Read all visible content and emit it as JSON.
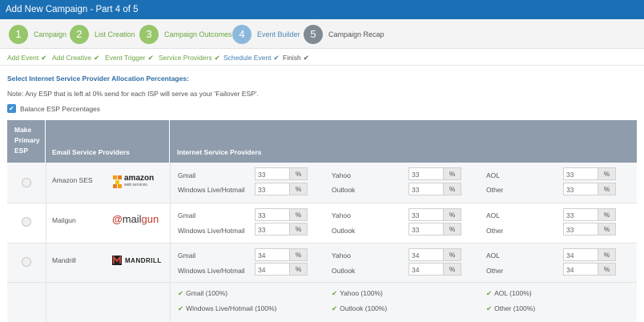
{
  "window": {
    "title": "Add New Campaign - Part 4 of 5"
  },
  "steps": [
    {
      "num": "1",
      "label": "Campaign"
    },
    {
      "num": "2",
      "label": "List Creation"
    },
    {
      "num": "3",
      "label": "Campaign Outcomes"
    },
    {
      "num": "4",
      "label": "Event Builder"
    },
    {
      "num": "5",
      "label": "Campaign Recap"
    }
  ],
  "substeps": [
    {
      "label": "Add Event",
      "check": "✔"
    },
    {
      "label": "Add Creative",
      "check": "✔"
    },
    {
      "label": "Event Trigger",
      "check": "✔"
    },
    {
      "label": "Service Providers",
      "check": "✔"
    },
    {
      "label": "Schedule Event",
      "check": "✔"
    },
    {
      "label": "Finish",
      "check": "✔"
    }
  ],
  "section_title": "Select Internet Service Provider Allocation Percentages:",
  "note": "Note: Any ESP that is left at 0% send for each ISP will serve as your 'Failover ESP'.",
  "balance": {
    "label": "Balance ESP Percentages",
    "checked": true,
    "check_glyph": "✔"
  },
  "table": {
    "headers": {
      "primary": "Make Primary ESP",
      "esp": "Email Service Providers",
      "isp": "Internet Service Providers"
    },
    "percent_sign": "%",
    "rows": [
      {
        "esp": "Amazon SES",
        "logo": {
          "text_main": "amazon",
          "text_sub": "web services",
          "icon": "amazon-cubes-icon"
        },
        "isps": [
          {
            "label": "Gmail",
            "value": "33"
          },
          {
            "label": "Windows Live/Hotmail",
            "value": "33"
          },
          {
            "label": "Yahoo",
            "value": "33"
          },
          {
            "label": "Outlook",
            "value": "33"
          },
          {
            "label": "AOL",
            "value": "33"
          },
          {
            "label": "Other",
            "value": "33"
          }
        ]
      },
      {
        "esp": "Mailgun",
        "logo": {
          "text_at": "@",
          "text_mail": "mail",
          "text_gun": "gun",
          "icon": "mailgun-logo"
        },
        "isps": [
          {
            "label": "Gmail",
            "value": "33"
          },
          {
            "label": "Windows Live/Hotmail",
            "value": "33"
          },
          {
            "label": "Yahoo",
            "value": "33"
          },
          {
            "label": "Outlook",
            "value": "33"
          },
          {
            "label": "AOL",
            "value": "33"
          },
          {
            "label": "Other",
            "value": "33"
          }
        ]
      },
      {
        "esp": "Mandrill",
        "logo": {
          "text_main": "MANDRILL",
          "icon": "mandrill-m-icon"
        },
        "isps": [
          {
            "label": "Gmail",
            "value": "34"
          },
          {
            "label": "Windows Live/Hotmail",
            "value": "34"
          },
          {
            "label": "Yahoo",
            "value": "34"
          },
          {
            "label": "Outlook",
            "value": "34"
          },
          {
            "label": "AOL",
            "value": "34"
          },
          {
            "label": "Other",
            "value": "34"
          }
        ]
      }
    ],
    "summary": [
      {
        "label": "Gmail (100%)",
        "tick": "✔"
      },
      {
        "label": "Windows Live/Hotmail (100%)",
        "tick": "✔"
      },
      {
        "label": "Yahoo (100%)",
        "tick": "✔"
      },
      {
        "label": "Outlook (100%)",
        "tick": "✔"
      },
      {
        "label": "AOL (100%)",
        "tick": "✔"
      },
      {
        "label": "Other (100%)",
        "tick": "✔"
      }
    ]
  },
  "colors": {
    "titlebar": "#1b6fb5",
    "step_done": "#97c66b",
    "step_active": "#8cb8dc",
    "step_current": "#7f8a93",
    "table_header": "#8e9cac",
    "amazon_orange": "#f39c12",
    "mailgun_red": "#c0392b"
  }
}
